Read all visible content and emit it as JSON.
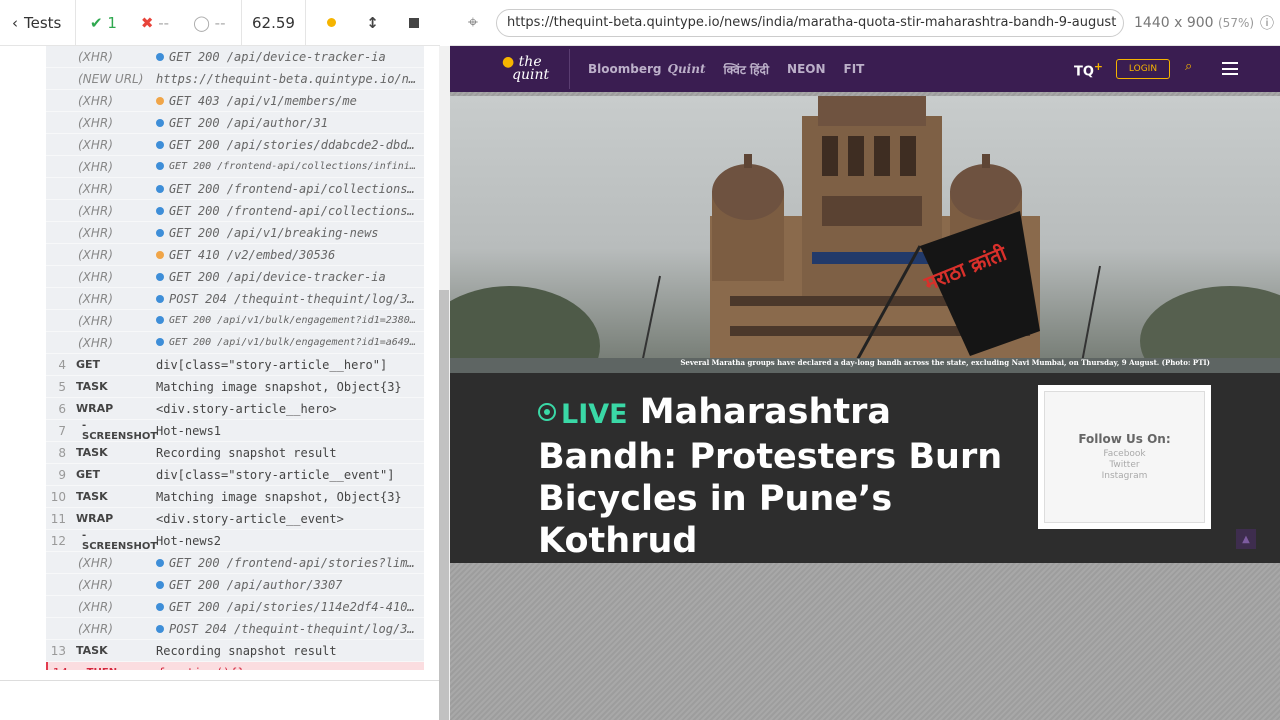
{
  "runner": {
    "tests_label": "Tests",
    "passed": "1",
    "failed": "--",
    "pending": "--",
    "duration": "62.59"
  },
  "log_rows": [
    {
      "type": "sub",
      "cmd": "(XHR)",
      "dot": "#3e8ed8",
      "msg": "GET 200 /api/device-tracker-ia"
    },
    {
      "type": "sub",
      "cmd": "(NEW URL)",
      "dot": "",
      "msg": "https://thequint-beta.quintype.io/n..."
    },
    {
      "type": "sub",
      "cmd": "(XHR)",
      "dot": "#f0a548",
      "msg": "GET 403 /api/v1/members/me"
    },
    {
      "type": "sub",
      "cmd": "(XHR)",
      "dot": "#3e8ed8",
      "msg": "GET 200 /api/author/31"
    },
    {
      "type": "sub",
      "cmd": "(XHR)",
      "dot": "#3e8ed8",
      "msg": "GET 200 /api/stories/ddabcde2-dbd..."
    },
    {
      "type": "sub small",
      "cmd": "(XHR)",
      "dot": "#3e8ed8",
      "msg": "GET 200 /frontend-api/collections/infini..."
    },
    {
      "type": "sub",
      "cmd": "(XHR)",
      "dot": "#3e8ed8",
      "msg": "GET 200 /frontend-api/collections..."
    },
    {
      "type": "sub",
      "cmd": "(XHR)",
      "dot": "#3e8ed8",
      "msg": "GET 200 /frontend-api/collections..."
    },
    {
      "type": "sub",
      "cmd": "(XHR)",
      "dot": "#3e8ed8",
      "msg": "GET 200 /api/v1/breaking-news"
    },
    {
      "type": "sub",
      "cmd": "(XHR)",
      "dot": "#f0a548",
      "msg": "GET 410 /v2/embed/30536"
    },
    {
      "type": "sub",
      "cmd": "(XHR)",
      "dot": "#3e8ed8",
      "msg": "GET 200 /api/device-tracker-ia"
    },
    {
      "type": "sub",
      "cmd": "(XHR)",
      "dot": "#3e8ed8",
      "msg": "POST 204 /thequint-thequint/log/3..."
    },
    {
      "type": "sub small",
      "cmd": "(XHR)",
      "dot": "#3e8ed8",
      "msg": "GET 200 /api/v1/bulk/engagement?id1=2380..."
    },
    {
      "type": "sub small",
      "cmd": "(XHR)",
      "dot": "#3e8ed8",
      "msg": "GET 200 /api/v1/bulk/engagement?id1=a649..."
    },
    {
      "type": "cmd-row",
      "num": "4",
      "cmd": "GET",
      "msg": "div[class=\"story-article__hero\"]"
    },
    {
      "type": "cmd-row",
      "num": "5",
      "cmd": "TASK",
      "msg": "Matching image snapshot, Object{3}"
    },
    {
      "type": "cmd-row",
      "num": "6",
      "cmd": "WRAP",
      "msg": "<div.story-article__hero>"
    },
    {
      "type": "child",
      "num": "7",
      "cmd": "-SCREENSHOT",
      "msg": "Hot-news1"
    },
    {
      "type": "cmd-row",
      "num": "8",
      "cmd": "TASK",
      "msg": "Recording snapshot result"
    },
    {
      "type": "cmd-row",
      "num": "9",
      "cmd": "GET",
      "msg": "div[class=\"story-article__event\"]"
    },
    {
      "type": "cmd-row",
      "num": "10",
      "cmd": "TASK",
      "msg": "Matching image snapshot, Object{3}"
    },
    {
      "type": "cmd-row",
      "num": "11",
      "cmd": "WRAP",
      "msg": "<div.story-article__event>"
    },
    {
      "type": "child",
      "num": "12",
      "cmd": "-SCREENSHOT",
      "msg": "Hot-news2"
    },
    {
      "type": "sub",
      "cmd": "(XHR)",
      "dot": "#3e8ed8",
      "msg": "GET 200 /frontend-api/stories?lim..."
    },
    {
      "type": "sub",
      "cmd": "(XHR)",
      "dot": "#3e8ed8",
      "msg": "GET 200 /api/author/3307"
    },
    {
      "type": "sub",
      "cmd": "(XHR)",
      "dot": "#3e8ed8",
      "msg": "GET 200 /api/stories/114e2df4-410..."
    },
    {
      "type": "sub",
      "cmd": "(XHR)",
      "dot": "#3e8ed8",
      "msg": "POST 204 /thequint-thequint/log/3..."
    },
    {
      "type": "cmd-row",
      "num": "13",
      "cmd": "TASK",
      "msg": "Recording snapshot result"
    },
    {
      "type": "child active",
      "num": "14",
      "cmd": "-THEN",
      "msg": "function(){}"
    }
  ],
  "aut": {
    "url": "https://thequint-beta.quintype.io/news/india/maratha-quota-stir-maharashtra-bandh-9-august",
    "viewport": "1440 x 900",
    "zoom": "(57%)"
  },
  "site": {
    "logo_line1": "the",
    "logo_line2": "quint",
    "nav": [
      "Bloomberg",
      "Quint",
      "क्विंट हिंदी",
      "NEON",
      "FIT"
    ],
    "tq": "TQ",
    "tq_plus": "+",
    "login": "LOGIN",
    "hero_caption": "Several Maratha groups have declared a day-long bandh across the state, excluding Navi Mumbai, on Thursday, 9 August. (Photo: PTI)",
    "banner_text_1": "मराठा क्रांती",
    "live_label": "LIVE",
    "headline": "Maharashtra Bandh: Protesters Burn Bicycles in Pune’s Kothrud",
    "follow_title": "Follow Us On:",
    "follow_links": [
      "Facebook",
      "Twitter",
      "Instagram"
    ]
  },
  "colors": {
    "site_nav": "#3a1d51",
    "accent_yellow": "#f5b400",
    "live_green": "#3ad8a6",
    "xhr_ok": "#3e8ed8",
    "xhr_warn": "#f0a548",
    "error_red": "#d5283e"
  }
}
